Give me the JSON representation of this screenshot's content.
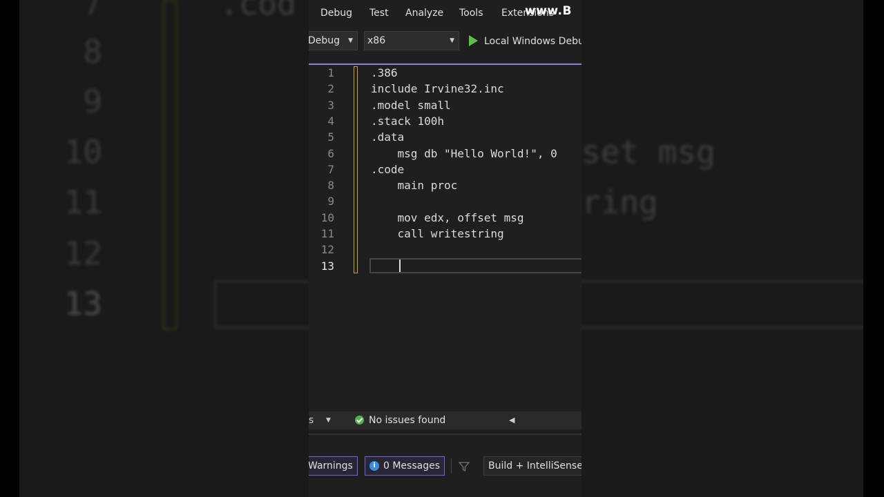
{
  "background": {
    "line_numbers": [
      "7",
      "8",
      "9",
      "10",
      "11",
      "12",
      "13"
    ],
    "code_fragments": [
      ".cod",
      "set msg",
      "ring"
    ]
  },
  "menu": {
    "items": [
      "Debug",
      "Test",
      "Analyze",
      "Tools",
      "Extensions"
    ],
    "watermark": "www.B"
  },
  "toolbar": {
    "config": "Debug",
    "platform": "x86",
    "start_target": "Local Windows Debu"
  },
  "editor": {
    "lines": [
      {
        "n": "1",
        "text": ".386"
      },
      {
        "n": "2",
        "text": "include Irvine32.inc"
      },
      {
        "n": "3",
        "text": ".model small"
      },
      {
        "n": "4",
        "text": ".stack 100h"
      },
      {
        "n": "5",
        "text": ".data"
      },
      {
        "n": "6",
        "text": "    msg db \"Hello World!\", 0"
      },
      {
        "n": "7",
        "text": ".code"
      },
      {
        "n": "8",
        "text": "    main proc"
      },
      {
        "n": "9",
        "text": ""
      },
      {
        "n": "10",
        "text": "    mov edx, offset msg"
      },
      {
        "n": "11",
        "text": "    call writestring"
      },
      {
        "n": "12",
        "text": ""
      },
      {
        "n": "13",
        "text": ""
      }
    ],
    "current_line": "13"
  },
  "status": {
    "issues": "No issues found",
    "left_fragment": "s"
  },
  "error_list": {
    "warnings": "Warnings",
    "messages": "0 Messages",
    "source": "Build + IntelliSense"
  },
  "colors": {
    "accent": "#8b82d8",
    "ok": "#4fb14f",
    "info": "#3b8de0",
    "run": "#5fbf4a"
  }
}
